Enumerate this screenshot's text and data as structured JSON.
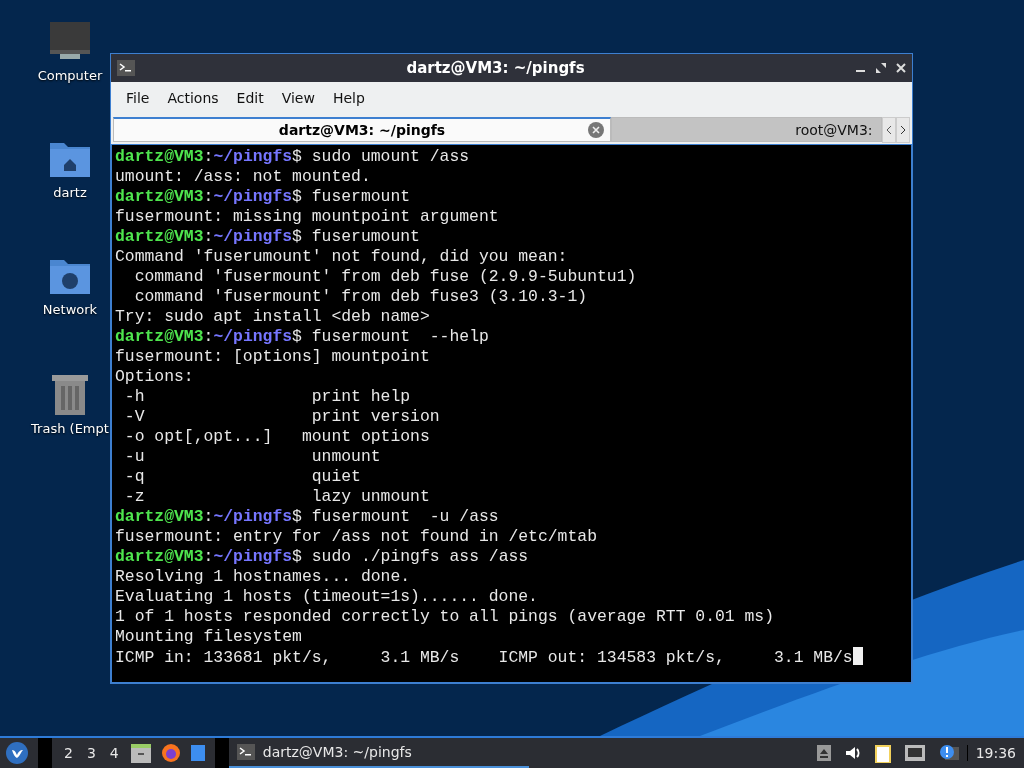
{
  "desktop_icons": [
    {
      "label": "Computer",
      "kind": "computer"
    },
    {
      "label": "dartz",
      "kind": "home"
    },
    {
      "label": "Network",
      "kind": "network"
    },
    {
      "label": "Trash (Empt",
      "kind": "trash"
    }
  ],
  "window": {
    "title": "dartz@VM3: ~/pingfs",
    "menu": [
      "File",
      "Actions",
      "Edit",
      "View",
      "Help"
    ],
    "tabs": [
      {
        "label": "dartz@VM3: ~/pingfs",
        "selected": true
      },
      {
        "label": "root@VM3: ",
        "selected": false
      }
    ],
    "terminal": {
      "cursor": true,
      "separator": ":",
      "prompt_sign": "$",
      "lines": [
        {
          "kind": "prompt",
          "user": "dartz@VM3",
          "path": "~/pingfs",
          "command": " sudo umount /ass"
        },
        {
          "kind": "output",
          "text": "umount: /ass: not mounted."
        },
        {
          "kind": "prompt",
          "user": "dartz@VM3",
          "path": "~/pingfs",
          "command": " fusermount"
        },
        {
          "kind": "output",
          "text": "fusermount: missing mountpoint argument"
        },
        {
          "kind": "prompt",
          "user": "dartz@VM3",
          "path": "~/pingfs",
          "command": " fuserumount"
        },
        {
          "kind": "output",
          "text": "Command 'fuserumount' not found, did you mean:"
        },
        {
          "kind": "output",
          "text": "  command 'fusermount' from deb fuse (2.9.9-5ubuntu1)"
        },
        {
          "kind": "output",
          "text": "  command 'fusermount' from deb fuse3 (3.10.3-1)"
        },
        {
          "kind": "output",
          "text": "Try: sudo apt install <deb name>"
        },
        {
          "kind": "prompt",
          "user": "dartz@VM3",
          "path": "~/pingfs",
          "command": " fusermount  --help"
        },
        {
          "kind": "output",
          "text": "fusermount: [options] mountpoint"
        },
        {
          "kind": "output",
          "text": "Options:"
        },
        {
          "kind": "output",
          "text": " -h                 print help"
        },
        {
          "kind": "output",
          "text": " -V                 print version"
        },
        {
          "kind": "output",
          "text": " -o opt[,opt...]   mount options"
        },
        {
          "kind": "output",
          "text": " -u                 unmount"
        },
        {
          "kind": "output",
          "text": " -q                 quiet"
        },
        {
          "kind": "output",
          "text": " -z                 lazy unmount"
        },
        {
          "kind": "prompt",
          "user": "dartz@VM3",
          "path": "~/pingfs",
          "command": " fusermount  -u /ass"
        },
        {
          "kind": "output",
          "text": "fusermount: entry for /ass not found in /etc/mtab"
        },
        {
          "kind": "prompt",
          "user": "dartz@VM3",
          "path": "~/pingfs",
          "command": " sudo ./pingfs ass /ass"
        },
        {
          "kind": "output",
          "text": "Resolving 1 hostnames... done."
        },
        {
          "kind": "output",
          "text": "Evaluating 1 hosts (timeout=1s)...... done."
        },
        {
          "kind": "output",
          "text": "1 of 1 hosts responded correctly to all pings (average RTT 0.01 ms)"
        },
        {
          "kind": "output",
          "text": "Mounting filesystem"
        },
        {
          "kind": "output",
          "text": "ICMP in: 133681 pkt/s,     3.1 MB/s    ICMP out: 134583 pkt/s,     3.1 MB/s"
        }
      ]
    }
  },
  "taskbar": {
    "workspaces": [
      "2",
      "3",
      "4"
    ],
    "launchers": [
      {
        "kind": "files"
      },
      {
        "kind": "browser"
      },
      {
        "kind": "blue"
      }
    ],
    "tasks": [
      {
        "label": "dartz@VM3: ~/pingfs",
        "selected": true
      }
    ],
    "tray": [
      {
        "kind": "eject"
      },
      {
        "kind": "volume"
      },
      {
        "kind": "clipboard"
      },
      {
        "kind": "network"
      },
      {
        "kind": "notification"
      }
    ],
    "clock": "19:36"
  }
}
